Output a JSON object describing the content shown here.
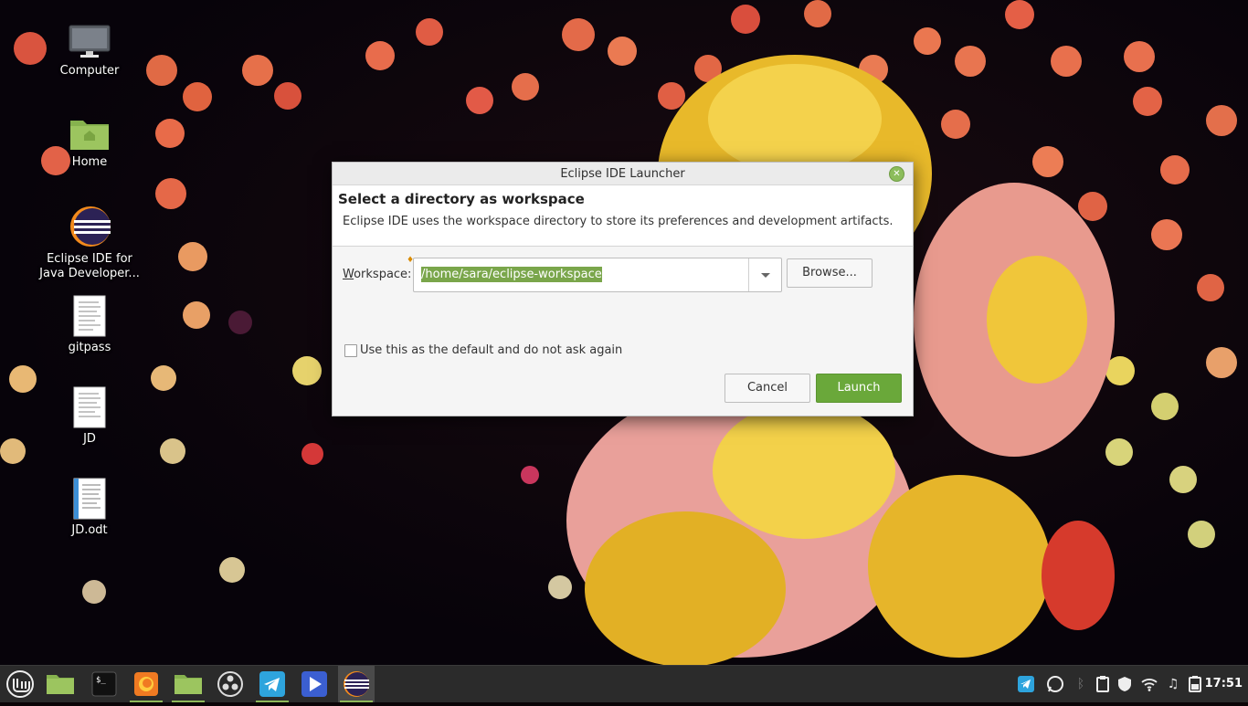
{
  "desktop": {
    "icons": [
      {
        "label": "Computer",
        "icon": "computer-icon"
      },
      {
        "label": "Home",
        "icon": "home-folder-icon"
      },
      {
        "label": "Eclipse IDE for\nJava Developer...",
        "icon": "eclipse-icon"
      },
      {
        "label": "gitpass",
        "icon": "text-document-icon"
      },
      {
        "label": "JD",
        "icon": "text-document-icon"
      },
      {
        "label": "JD.odt",
        "icon": "odt-document-icon"
      }
    ]
  },
  "dialog": {
    "title": "Eclipse IDE Launcher",
    "heading": "Select a directory as workspace",
    "description": "Eclipse IDE uses the workspace directory to store its preferences and development artifacts.",
    "workspace_label_mnemonic": "W",
    "workspace_label_rest": "orkspace:",
    "workspace_value": "/home/sara/eclipse-workspace",
    "browse_label": "Browse...",
    "default_checkbox_label": "Use this as the default and do not ask again",
    "default_checked": false,
    "cancel_label": "Cancel",
    "launch_label": "Launch",
    "accent_color": "#6aa83a"
  },
  "taskbar": {
    "apps": [
      "mint-menu-icon",
      "files-icon",
      "terminal-icon",
      "firefox-icon",
      "folder-icon",
      "obs-icon",
      "telegram-icon",
      "video-player-icon",
      "eclipse-icon"
    ],
    "tray": [
      "telegram-tray-icon",
      "whatsapp-tray-icon",
      "bluetooth-icon",
      "clipboard-icon",
      "shield-icon",
      "wifi-icon",
      "music-icon",
      "battery-icon"
    ],
    "clock": "17:51"
  }
}
